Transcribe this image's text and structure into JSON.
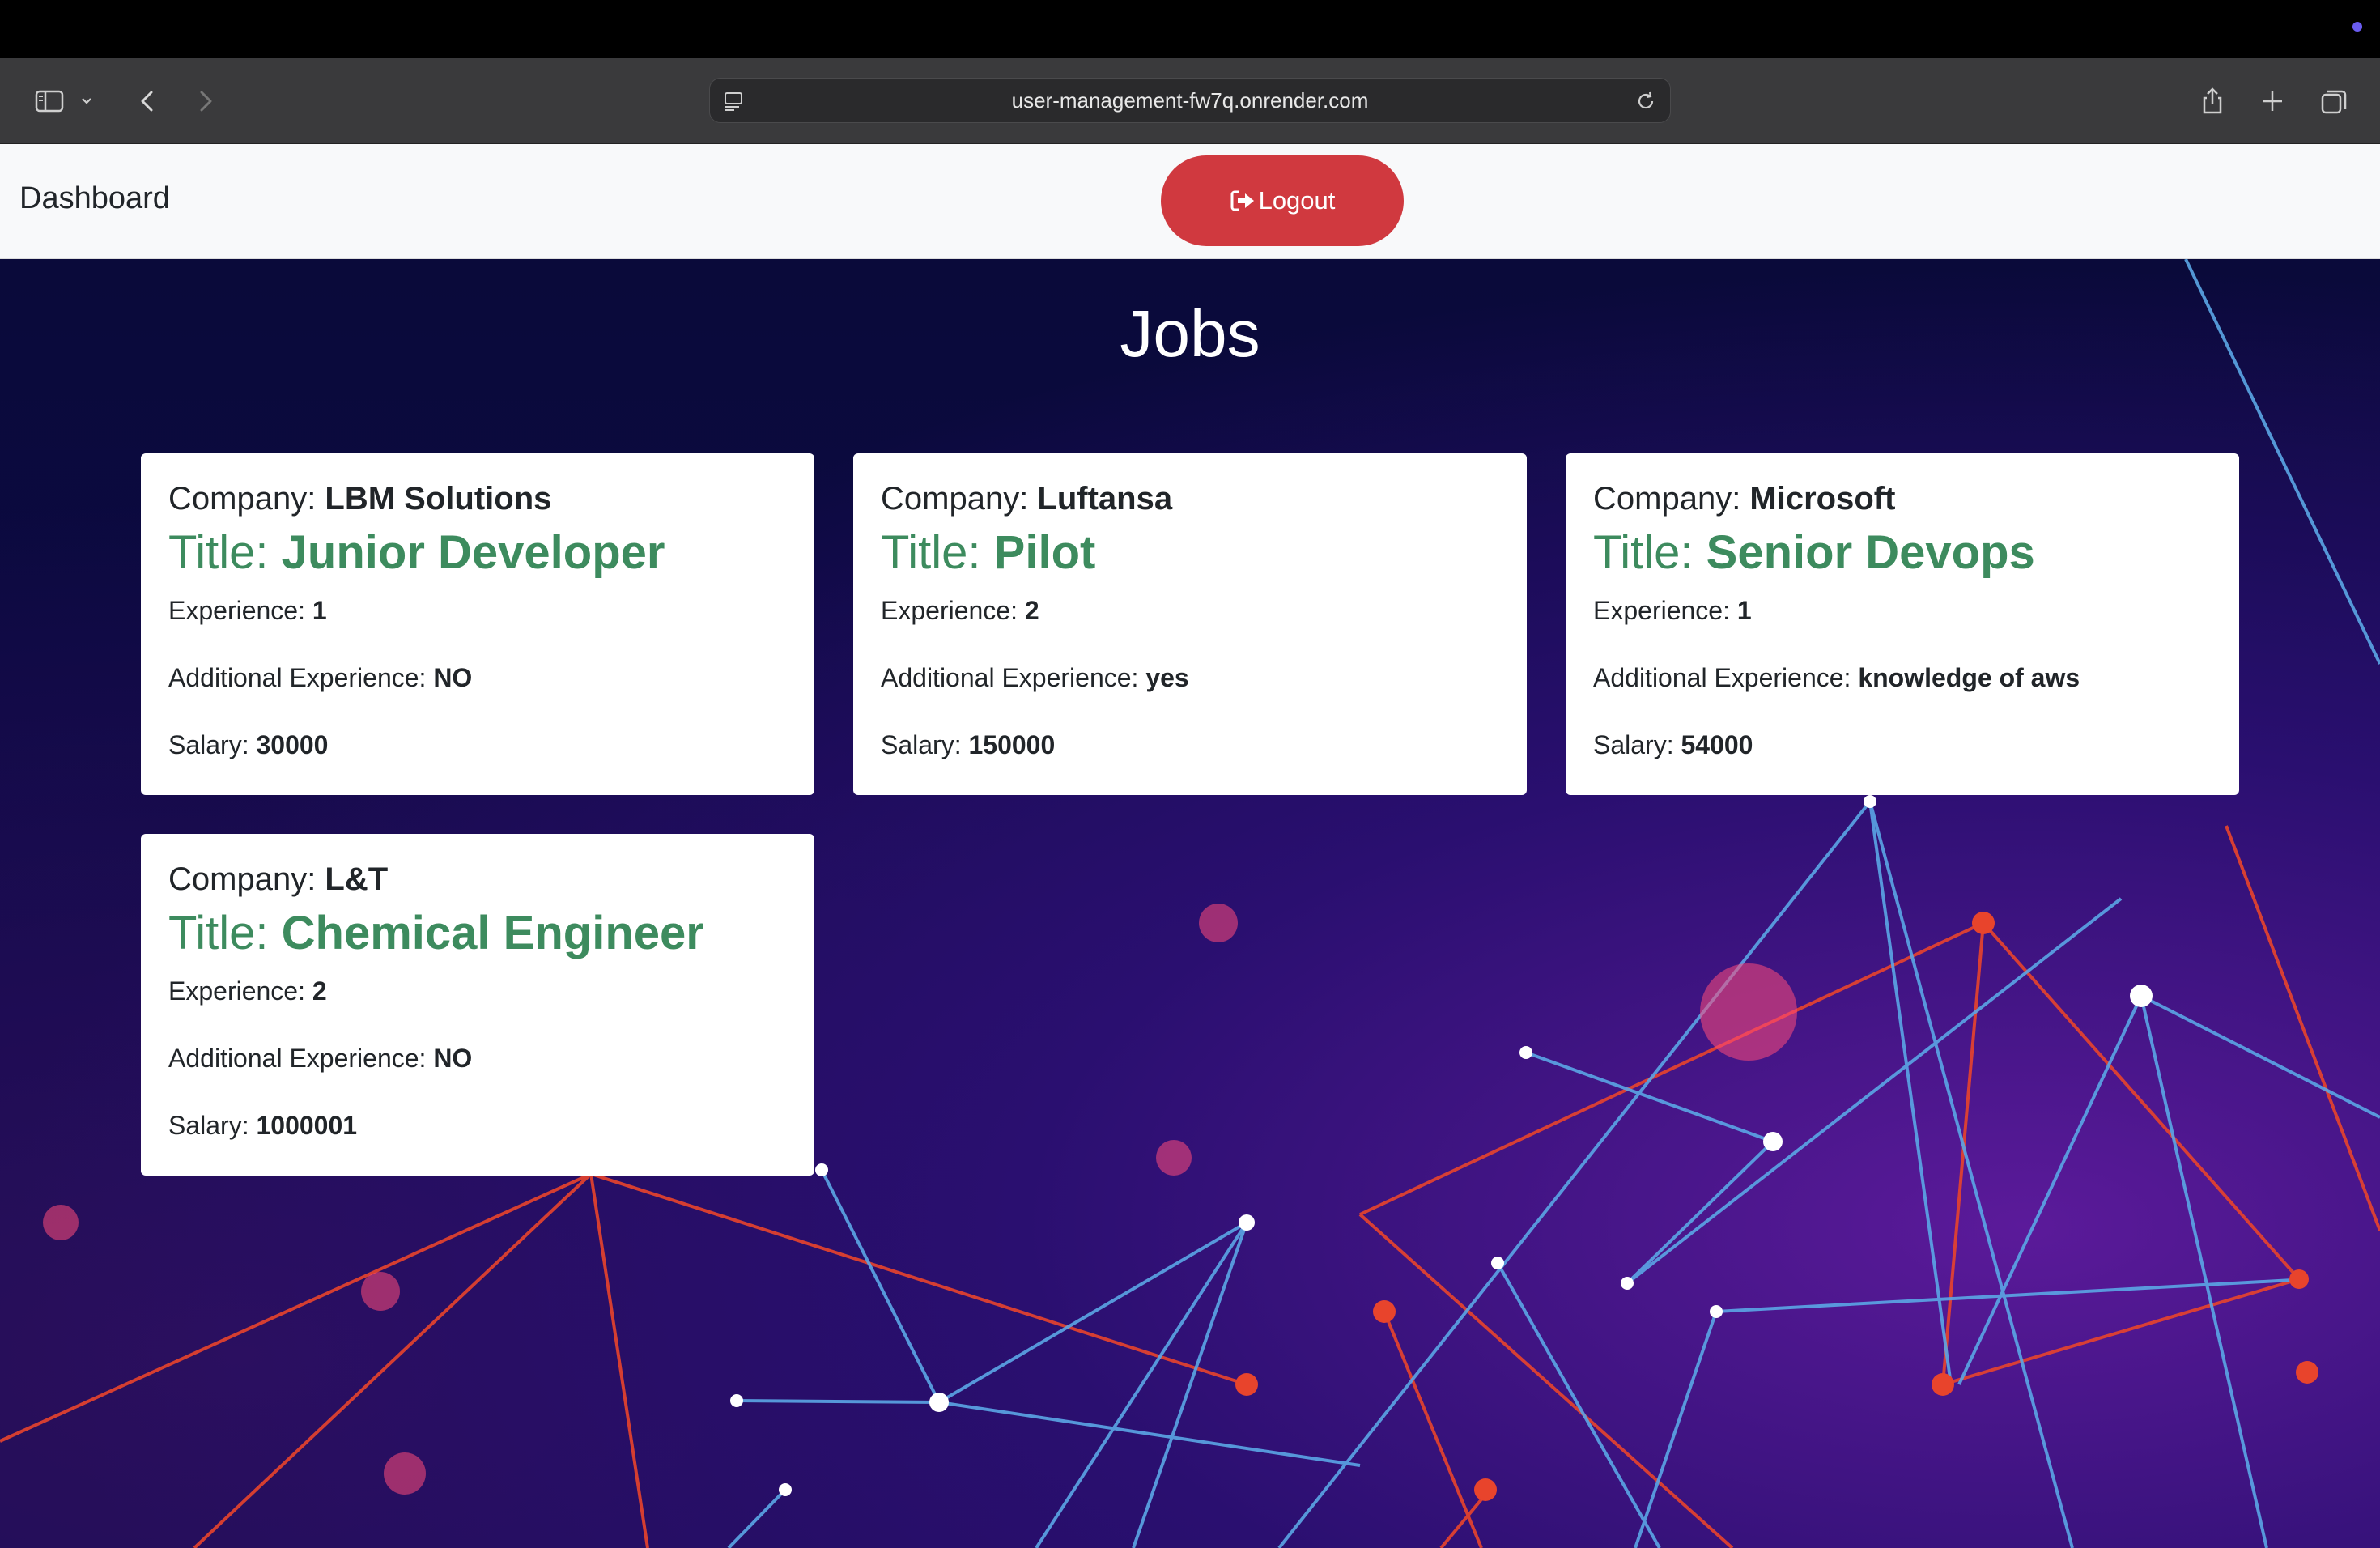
{
  "browser": {
    "url": "user-management-fw7q.onrender.com"
  },
  "navbar": {
    "brand": "Dashboard",
    "logout_label": "Logout"
  },
  "page": {
    "heading": "Jobs"
  },
  "labels": {
    "company": "Company: ",
    "title": "Title: ",
    "experience": "Experience: ",
    "additional": "Additional Experience: ",
    "salary": "Salary: "
  },
  "jobs": [
    {
      "company": "LBM Solutions",
      "title": "Junior Developer",
      "experience": "1",
      "additional": "NO",
      "salary": "30000"
    },
    {
      "company": "Luftansa",
      "title": "Pilot",
      "experience": "2",
      "additional": "yes",
      "salary": "150000"
    },
    {
      "company": "Microsoft",
      "title": "Senior Devops",
      "experience": "1",
      "additional": "knowledge of aws",
      "salary": "54000"
    },
    {
      "company": "L&T",
      "title": "Chemical Engineer",
      "experience": "2",
      "additional": "NO",
      "salary": "1000001"
    }
  ],
  "colors": {
    "logout": "#d0393f",
    "title_green": "#3d8b5e",
    "navbar_bg": "#f8f9fa"
  }
}
